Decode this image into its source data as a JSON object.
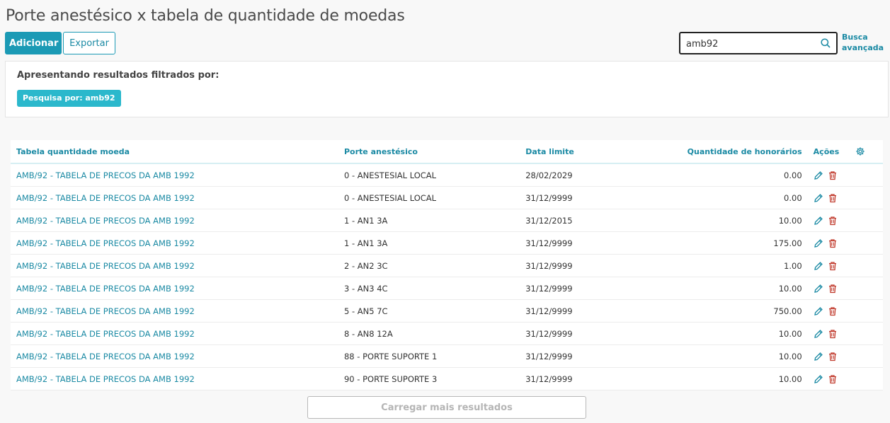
{
  "page": {
    "title": "Porte anestésico x tabela de quantidade de moedas"
  },
  "toolbar": {
    "add_label": "Adicionar",
    "export_label": "Exportar"
  },
  "search": {
    "value": "amb92",
    "advanced_label": "Busca avançada"
  },
  "filters": {
    "heading": "Apresentando resultados filtrados por:",
    "chip": "Pesquisa por: amb92"
  },
  "table": {
    "headers": {
      "tabela": "Tabela quantidade moeda",
      "porte": "Porte anestésico",
      "data": "Data limite",
      "quantidade": "Quantidade de honorários",
      "acoes": "Ações"
    },
    "rows": [
      {
        "tabela": "AMB/92 - TABELA DE PRECOS DA AMB 1992",
        "porte": "0 - ANESTESIAL LOCAL",
        "data": "28/02/2029",
        "quantidade": "0.00"
      },
      {
        "tabela": "AMB/92 - TABELA DE PRECOS DA AMB 1992",
        "porte": "0 - ANESTESIAL LOCAL",
        "data": "31/12/9999",
        "quantidade": "0.00"
      },
      {
        "tabela": "AMB/92 - TABELA DE PRECOS DA AMB 1992",
        "porte": "1 - AN1 3A",
        "data": "31/12/2015",
        "quantidade": "10.00"
      },
      {
        "tabela": "AMB/92 - TABELA DE PRECOS DA AMB 1992",
        "porte": "1 - AN1 3A",
        "data": "31/12/9999",
        "quantidade": "175.00"
      },
      {
        "tabela": "AMB/92 - TABELA DE PRECOS DA AMB 1992",
        "porte": "2 - AN2 3C",
        "data": "31/12/9999",
        "quantidade": "1.00"
      },
      {
        "tabela": "AMB/92 - TABELA DE PRECOS DA AMB 1992",
        "porte": "3 - AN3 4C",
        "data": "31/12/9999",
        "quantidade": "10.00"
      },
      {
        "tabela": "AMB/92 - TABELA DE PRECOS DA AMB 1992",
        "porte": "5 - AN5 7C",
        "data": "31/12/9999",
        "quantidade": "750.00"
      },
      {
        "tabela": "AMB/92 - TABELA DE PRECOS DA AMB 1992",
        "porte": "8 - AN8 12A",
        "data": "31/12/9999",
        "quantidade": "10.00"
      },
      {
        "tabela": "AMB/92 - TABELA DE PRECOS DA AMB 1992",
        "porte": "88 - PORTE SUPORTE 1",
        "data": "31/12/9999",
        "quantidade": "10.00"
      },
      {
        "tabela": "AMB/92 - TABELA DE PRECOS DA AMB 1992",
        "porte": "90 - PORTE SUPORTE 3",
        "data": "31/12/9999",
        "quantidade": "10.00"
      }
    ]
  },
  "load_more_label": "Carregar mais resultados",
  "icons": {
    "search": "search-icon",
    "edit": "pencil-icon",
    "delete": "trash-icon",
    "settings": "gear-icon"
  },
  "colors": {
    "primary": "#1b9ab5",
    "chip": "#2bb8cc",
    "delete": "#c0392b"
  }
}
